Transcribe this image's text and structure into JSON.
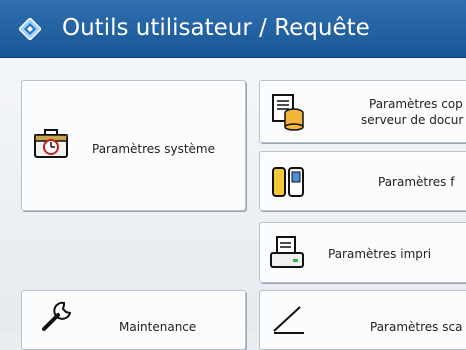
{
  "header": {
    "title": "Outils utilisateur / Requête"
  },
  "menu": {
    "system_settings": "Paramètres système",
    "copy_settings_line1": "Paramètres cop",
    "copy_settings_line2": "serveur de docur",
    "fax_settings": "Paramètres f",
    "printer_settings": "Paramètres impri",
    "maintenance": "Maintenance",
    "scanner_settings": "Paramètres sca"
  }
}
